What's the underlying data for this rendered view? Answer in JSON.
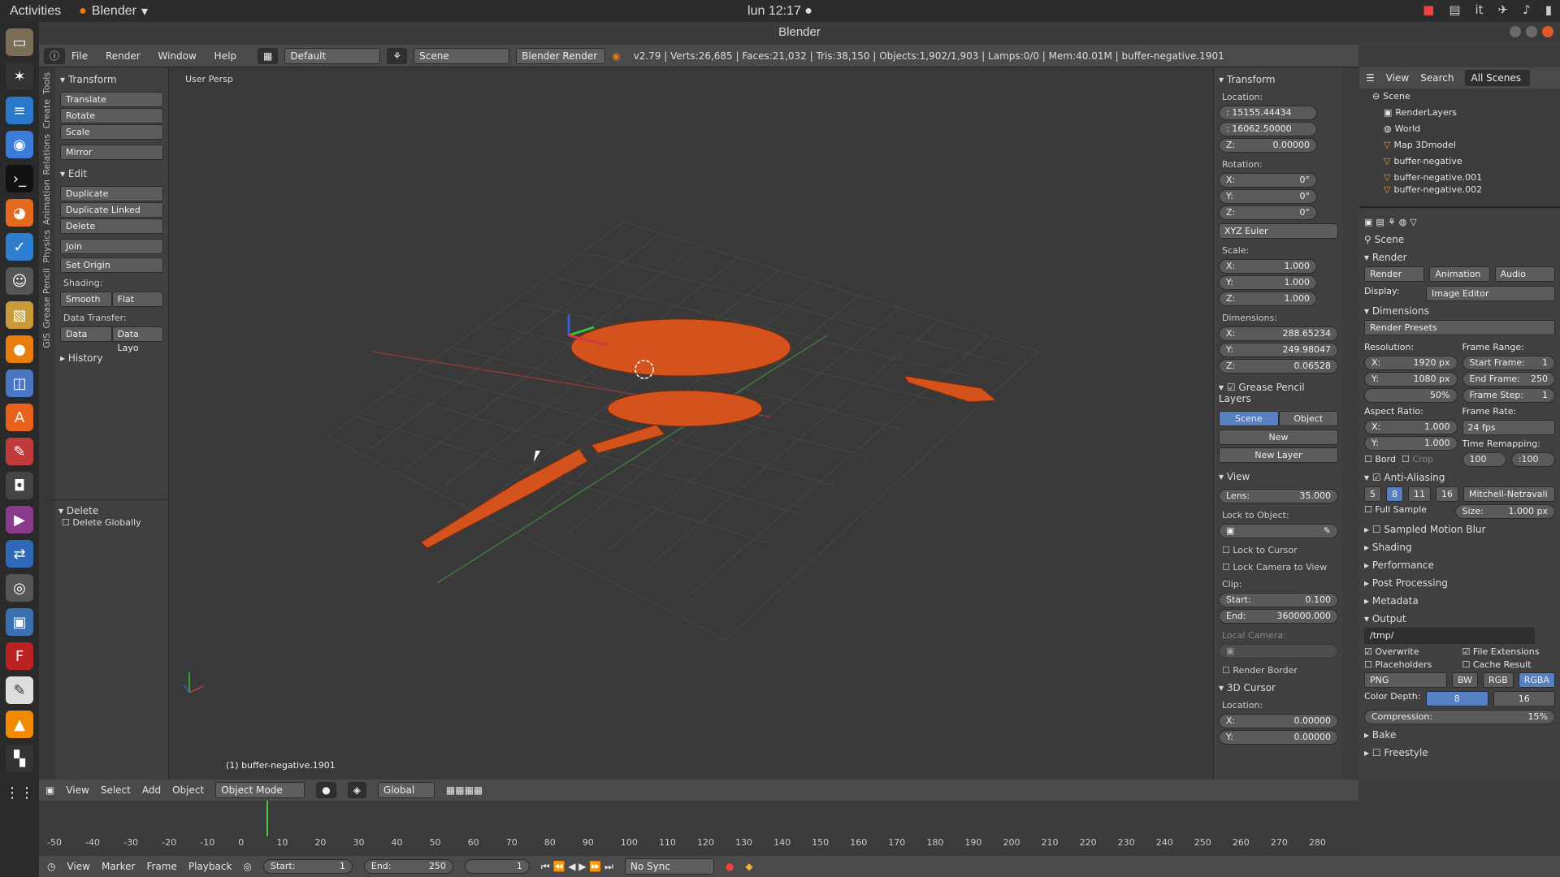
{
  "os": {
    "activities": "Activities",
    "app_name": "Blender",
    "clock": "lun 12:17 ●",
    "lang": "it"
  },
  "window": {
    "title": "Blender"
  },
  "header": {
    "menus": [
      "File",
      "Render",
      "Window",
      "Help"
    ],
    "layout": "Default",
    "scene": "Scene",
    "engine": "Blender Render",
    "stats": "v2.79 | Verts:26,685 | Faces:21,032 | Tris:38,150 | Objects:1,902/1,903 | Lamps:0/0 | Mem:40.01M | buffer-negative.1901"
  },
  "tabs": [
    "Tools",
    "Create",
    "Relations",
    "Animation",
    "Physics",
    "Grease Pencil",
    "GIS"
  ],
  "tools": {
    "transform_title": "Transform",
    "translate": "Translate",
    "rotate": "Rotate",
    "scale": "Scale",
    "mirror": "Mirror",
    "edit_title": "Edit",
    "duplicate": "Duplicate",
    "duplicate_linked": "Duplicate Linked",
    "delete": "Delete",
    "join": "Join",
    "set_origin": "Set Origin",
    "shading_label": "Shading:",
    "smooth": "Smooth",
    "flat": "Flat",
    "data_transfer_label": "Data Transfer:",
    "data": "Data",
    "data_layo": "Data Layo",
    "history": "History",
    "delete_title": "Delete",
    "delete_globally": "Delete Globally"
  },
  "viewport": {
    "label": "User Persp",
    "object_label": "(1) buffer-negative.1901"
  },
  "transform_panel": {
    "title": "Transform",
    "location_label": "Location:",
    "location": [
      ": 15155.44434",
      ": 16062.50000"
    ],
    "loc_z_key": "Z:",
    "loc_z": "0.00000",
    "rotation_label": "Rotation:",
    "rot_keys": [
      "X:",
      "Y:",
      "Z:"
    ],
    "rot_vals": [
      "0°",
      "0°",
      "0°"
    ],
    "euler": "XYZ Euler",
    "scale_label": "Scale:",
    "scale_keys": [
      "X:",
      "Y:",
      "Z:"
    ],
    "scale_vals": [
      "1.000",
      "1.000",
      "1.000"
    ],
    "dimensions_label": "Dimensions:",
    "dim_keys": [
      "X:",
      "Y:",
      "Z:"
    ],
    "dim_vals": [
      "288.65234",
      "249.98047",
      "0.06528"
    ],
    "gp_title": "Grease Pencil Layers",
    "gp_scene": "Scene",
    "gp_object": "Object",
    "gp_new": "New",
    "gp_new_layer": "New Layer",
    "view_title": "View",
    "lens_key": "Lens:",
    "lens_val": "35.000",
    "lock_to_object": "Lock to Object:",
    "lock_to_cursor": "Lock to Cursor",
    "lock_camera": "Lock Camera to View",
    "clip_label": "Clip:",
    "clip_start_key": "Start:",
    "clip_start": "0.100",
    "clip_end_key": "End:",
    "clip_end": "360000.000",
    "local_camera": "Local Camera:",
    "render_border": "Render Border",
    "cursor_title": "3D Cursor",
    "cursor_location": "Location:",
    "cursor_keys": [
      "X:",
      "Y:"
    ],
    "cursor_vals": [
      "0.00000",
      "0.00000"
    ]
  },
  "outliner": {
    "menus": [
      "View",
      "Search"
    ],
    "filter": "All Scenes",
    "items": [
      "Scene",
      "RenderLayers",
      "World",
      "Map 3Dmodel",
      "buffer-negative",
      "buffer-negative.001",
      "buffer-negative.002"
    ]
  },
  "properties": {
    "scene": "Scene",
    "render_title": "Render",
    "render_btn": "Render",
    "animation_btn": "Animation",
    "audio_btn": "Audio",
    "display_label": "Display:",
    "display_value": "Image Editor",
    "dimensions_title": "Dimensions",
    "render_presets": "Render Presets",
    "resolution_label": "Resolution:",
    "res_x_key": "X:",
    "res_x": "1920 px",
    "res_y_key": "Y:",
    "res_y": "1080 px",
    "res_pct": "50%",
    "frame_range_label": "Frame Range:",
    "start_frame_key": "Start Frame:",
    "start_frame": "1",
    "end_frame_key": "End Frame:",
    "end_frame": "250",
    "frame_step_key": "Frame Step:",
    "frame_step": "1",
    "aspect_label": "Aspect Ratio:",
    "aspect_x_key": "X:",
    "aspect_x": "1.000",
    "aspect_y_key": "Y:",
    "aspect_y": "1.000",
    "frame_rate_label": "Frame Rate:",
    "frame_rate": "24 fps",
    "time_remap_label": "Time Remapping:",
    "remap_old": "100",
    "remap_new": ":100",
    "bord": "Bord",
    "crop": "Crop",
    "aa_title": "Anti-Aliasing",
    "aa_samples": [
      "5",
      "8",
      "11",
      "16"
    ],
    "aa_filter": "Mitchell-Netravali",
    "full_sample": "Full Sample",
    "aa_size_key": "Size:",
    "aa_size": "1.000 px",
    "motion_blur": "Sampled Motion Blur",
    "shading": "Shading",
    "performance": "Performance",
    "post_processing": "Post Processing",
    "metadata": "Metadata",
    "output_title": "Output",
    "output_path": "/tmp/",
    "overwrite": "Overwrite",
    "file_ext": "File Extensions",
    "placeholders": "Placeholders",
    "cache_result": "Cache Result",
    "format": "PNG",
    "bw": "BW",
    "rgb": "RGB",
    "rgba": "RGBA",
    "color_depth_label": "Color Depth:",
    "depth_8": "8",
    "depth_16": "16",
    "compression_key": "Compression:",
    "compression": "15%",
    "bake": "Bake",
    "freestyle": "Freestyle"
  },
  "view3d_header": {
    "menus": [
      "View",
      "Select",
      "Add",
      "Object"
    ],
    "mode": "Object Mode",
    "orientation": "Global"
  },
  "timeline": {
    "ticks": [
      "-50",
      "-40",
      "-30",
      "-20",
      "-10",
      "0",
      "10",
      "20",
      "30",
      "40",
      "50",
      "60",
      "70",
      "80",
      "90",
      "100",
      "110",
      "120",
      "130",
      "140",
      "150",
      "160",
      "170",
      "180",
      "190",
      "200",
      "210",
      "220",
      "230",
      "240",
      "250",
      "260",
      "270",
      "280"
    ],
    "menus": [
      "View",
      "Marker",
      "Frame",
      "Playback"
    ],
    "start_key": "Start:",
    "start": "1",
    "end_key": "End:",
    "end": "250",
    "current": "1",
    "sync": "No Sync"
  }
}
